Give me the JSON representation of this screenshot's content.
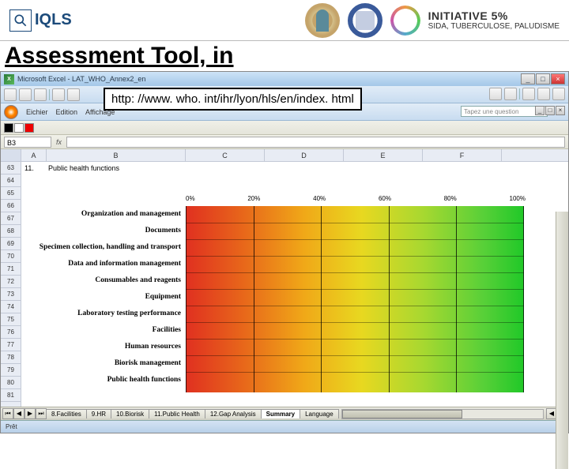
{
  "header": {
    "iqls": "IQLS",
    "initiative_big": "INITIATIVE 5%",
    "initiative_small": "SIDA, TUBERCULOSE, PALUDISME"
  },
  "heading": "Assessment Tool, in",
  "url_callout": "http: //www. who. int/ihr/lyon/hls/en/index. html",
  "excel": {
    "app": "Microsoft Excel",
    "doc": "LAT_WHO_Annex2_en",
    "menu": [
      "Eichier",
      "Edition",
      "Affichage"
    ],
    "question_placeholder": "Tapez une question",
    "name_box": "B3",
    "formula_value": ""
  },
  "grid": {
    "cols": [
      "A",
      "B",
      "C",
      "D",
      "E",
      "F"
    ],
    "rows": [
      "63",
      "64",
      "65",
      "66",
      "67",
      "68",
      "69",
      "70",
      "71",
      "72",
      "73",
      "74",
      "75",
      "76",
      "77",
      "78",
      "79",
      "80",
      "81"
    ],
    "row63_a": "11.",
    "row63_b": "Public health functions"
  },
  "chart_data": {
    "type": "bar",
    "title": "",
    "xlabel": "",
    "ylabel": "",
    "xlim": [
      0,
      100
    ],
    "x_ticks": [
      "0%",
      "20%",
      "40%",
      "60%",
      "80%",
      "100%"
    ],
    "categories": [
      "Organization and management",
      "Documents",
      "Specimen collection, handling and transport",
      "Data and information management",
      "Consumables and reagents",
      "Equipment",
      "Laboratory testing performance",
      "Facilities",
      "Human resources",
      "Biorisk management",
      "Public health functions"
    ],
    "values": [
      null,
      null,
      null,
      null,
      null,
      null,
      null,
      null,
      null,
      null,
      null
    ],
    "note": "Bars rendered over a red-to-green 0–100% gradient; individual bar positions not visually resolvable in source image."
  },
  "sheets": {
    "tabs": [
      "8.Facilities",
      "9.HR",
      "10.Biorisk",
      "11.Public Health",
      "12.Gap Analysis",
      "Summary",
      "Language"
    ],
    "active": "Summary"
  },
  "status": "Prêt",
  "win_btns": {
    "min": "_",
    "max": "□",
    "close": "×"
  },
  "nav": {
    "first": "⏮",
    "prev": "◀",
    "next": "▶",
    "last": "⏭"
  }
}
